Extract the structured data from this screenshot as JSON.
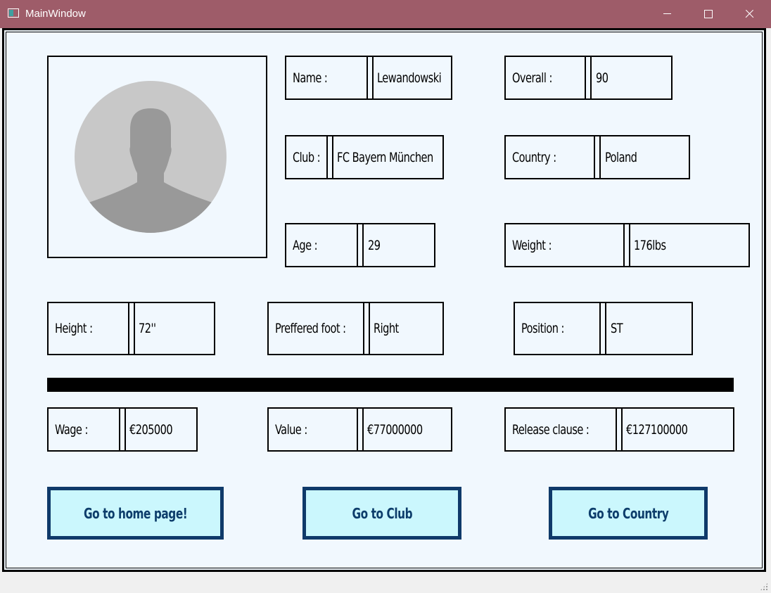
{
  "window": {
    "title": "MainWindow"
  },
  "player": {
    "name": {
      "label": "Name :",
      "value": "Lewandowski"
    },
    "overall": {
      "label": "Overall :",
      "value": "90"
    },
    "club": {
      "label": "Club :",
      "value": "FC Bayern München"
    },
    "country": {
      "label": "Country :",
      "value": "Poland"
    },
    "age": {
      "label": "Age :",
      "value": "29"
    },
    "weight": {
      "label": "Weight :",
      "value": "176lbs"
    },
    "height": {
      "label": "Height :",
      "value": "72''"
    },
    "foot": {
      "label": "Preffered foot :",
      "value": "Right"
    },
    "position": {
      "label": "Position  :",
      "value": "ST"
    },
    "wage": {
      "label": "Wage :",
      "value": "€205000"
    },
    "value": {
      "label": "Value :",
      "value": "€77000000"
    },
    "release": {
      "label": "Release clause :",
      "value": "€127100000"
    }
  },
  "buttons": {
    "home": "Go to home page!",
    "club": "Go to Club",
    "country": "Go to Country"
  },
  "colors": {
    "titlebar": "#9e5c69",
    "panel": "#f1f8fe",
    "button_bg": "#cbf7fd",
    "button_border": "#0f3a6a",
    "button_text": "#0d3d6b"
  },
  "icons": {
    "avatar": "user-silhouette-icon",
    "app": "window-app-icon"
  }
}
